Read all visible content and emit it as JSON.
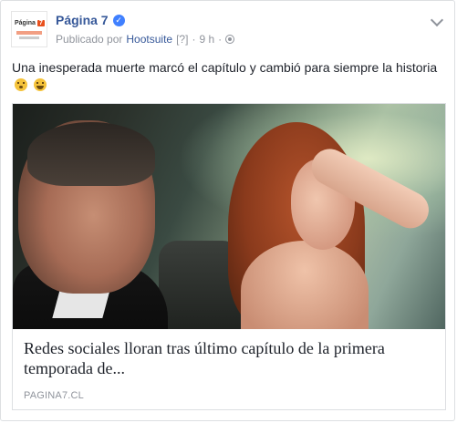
{
  "post": {
    "page_name": "Página 7",
    "verified_icon": "check-icon",
    "published_by_label": "Publicado por",
    "published_by_app": "Hootsuite",
    "help_marker": "[?]",
    "separator": "·",
    "time": "9 h",
    "audience_icon": "globe-icon",
    "options_icon": "chevron-down-icon",
    "text": "Una inesperada muerte marcó el capítulo y cambió para siempre la historia",
    "emojis": [
      "sad-face-icon",
      "crying-face-icon"
    ]
  },
  "avatar": {
    "logo_text": "Página",
    "logo_badge": "7"
  },
  "link_preview": {
    "title": "Redes sociales lloran tras último capítulo de la primera temporada de...",
    "domain": "PAGINA7.CL"
  },
  "colors": {
    "link_blue": "#365899",
    "meta_gray": "#90949c",
    "verified_blue": "#4080ff",
    "brand_orange": "#e8501d",
    "border": "#dddfe2"
  }
}
